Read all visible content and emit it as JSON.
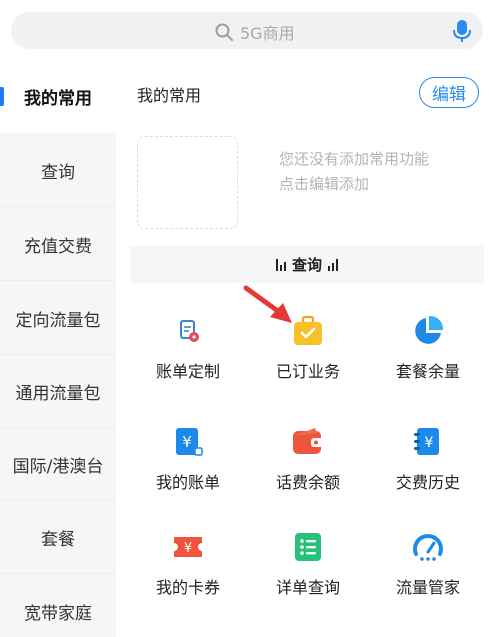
{
  "search": {
    "placeholder": "5G商用"
  },
  "sidebar": {
    "items": [
      {
        "label": "我的常用",
        "active": true
      },
      {
        "label": "查询"
      },
      {
        "label": "充值交费"
      },
      {
        "label": "定向流量包"
      },
      {
        "label": "通用流量包"
      },
      {
        "label": "国际/港澳台"
      },
      {
        "label": "套餐"
      },
      {
        "label": "宽带家庭"
      }
    ]
  },
  "main": {
    "title": "我的常用",
    "edit_label": "编辑",
    "empty_line1": "您还没有添加常用功能",
    "empty_line2": "点击编辑添加",
    "section_label": "查询",
    "items": [
      {
        "label": "账单定制",
        "icon": "bill-customize-icon"
      },
      {
        "label": "已订业务",
        "icon": "subscribed-services-icon"
      },
      {
        "label": "套餐余量",
        "icon": "plan-balance-icon"
      },
      {
        "label": "我的账单",
        "icon": "my-bill-icon"
      },
      {
        "label": "话费余额",
        "icon": "phone-balance-icon"
      },
      {
        "label": "交费历史",
        "icon": "payment-history-icon"
      },
      {
        "label": "我的卡券",
        "icon": "coupon-icon"
      },
      {
        "label": "详单查询",
        "icon": "detail-query-icon"
      },
      {
        "label": "流量管家",
        "icon": "data-manager-icon"
      }
    ]
  },
  "colors": {
    "accent": "#2a8bea",
    "active_mark": "#1d7cf2",
    "arrow": "#e53935"
  }
}
